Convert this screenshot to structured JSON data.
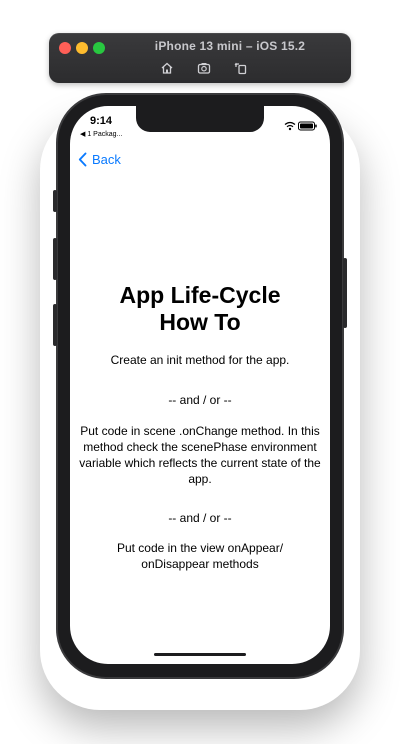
{
  "simulator": {
    "title": "iPhone 13 mini – iOS 15.2",
    "toolbar_icons": [
      "home-icon",
      "screenshot-icon",
      "rotate-icon"
    ]
  },
  "status_bar": {
    "time": "9:14",
    "back_app": "◀ 1 Packag...",
    "icons": [
      "wifi-icon",
      "battery-icon"
    ]
  },
  "nav": {
    "back_label": "Back"
  },
  "content": {
    "title": "App Life-Cycle How To",
    "items": [
      "Create an init method for the app.",
      "-- and / or --",
      "Put code in scene .onChange method. In this method check the scenePhase environment variable which reflects the current state of the app.",
      "-- and / or --",
      "Put code in the view onAppear/ onDisappear methods"
    ]
  },
  "colors": {
    "accent": "#0a7aff",
    "simulator_toolbar": "#2c2c2e",
    "phone_frame": "#1c1c1e"
  }
}
